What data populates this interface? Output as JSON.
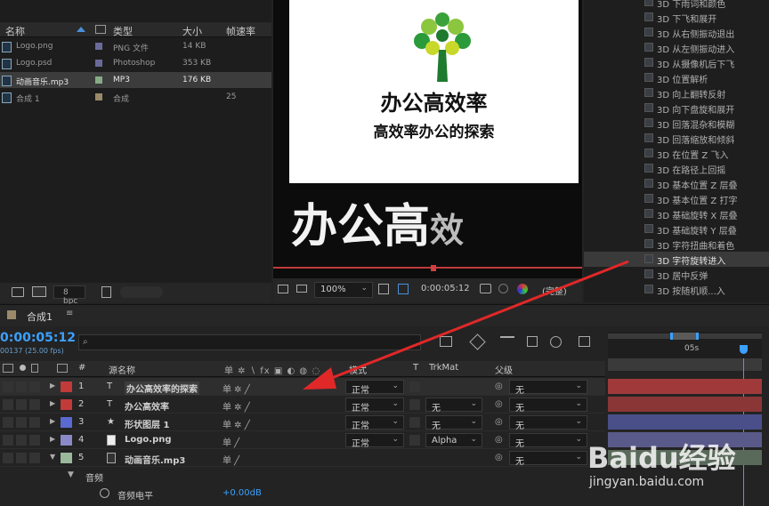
{
  "project": {
    "columns": {
      "name": "名称",
      "type": "类型",
      "size": "大小",
      "fps": "帧速率"
    },
    "items": [
      {
        "name": "Logo.png",
        "color": "#6a6a9a",
        "type": "PNG 文件",
        "size": "14 KB",
        "fps": ""
      },
      {
        "name": "Logo.psd",
        "color": "#6a6a9a",
        "type": "Photoshop",
        "size": "353 KB",
        "fps": ""
      },
      {
        "name": "动画音乐.mp3",
        "color": "#88aa88",
        "type": "MP3",
        "size": "176 KB",
        "fps": ""
      },
      {
        "name": "合成 1",
        "color": "#9a8a6a",
        "type": "合成",
        "size": "",
        "fps": "25"
      }
    ],
    "bpc": "8 bpc"
  },
  "viewer": {
    "logo_line1": "办公高效率",
    "logo_line2": "高效率办公的探索",
    "animated_text": "办公高",
    "animated_text_faded": "效",
    "zoom": "100%",
    "timecode": "0:00:05:12",
    "quality": "(完整)"
  },
  "effects": {
    "items": [
      "3D 下雨词和颜色",
      "3D 下飞和展开",
      "3D 从右侧振动退出",
      "3D 从左侧振动进入",
      "3D 从摄像机后下飞",
      "3D 位置解析",
      "3D 向上翻转反射",
      "3D 向下盘旋和展开",
      "3D 回落混杂和模糊",
      "3D 回落缩放和倾斜",
      "3D 在位置 Z 飞入",
      "3D 在路径上回摇",
      "3D 基本位置 Z 层叠",
      "3D 基本位置 Z 打字",
      "3D 基础旋转 X 层叠",
      "3D 基础旋转 Y 层叠",
      "3D 字符扭曲和着色",
      "3D 字符旋转进入",
      "3D 居中反弹",
      "3D 按随机顺...入"
    ],
    "selected_index": 17
  },
  "timeline": {
    "tab": "合成1",
    "timecode": "0:00:05:12",
    "frame_info": "00137 (25.00 fps)",
    "search_placeholder": "ρ.",
    "ruler_label": "05s",
    "headers": {
      "num": "#",
      "source": "源名称",
      "mode": "模式",
      "t": "T",
      "trkmat": "TrkMat",
      "parent": "父级"
    },
    "layers": [
      {
        "num": "1",
        "kind": "T",
        "name": "办公高效率的探索",
        "color": "#c23a3a",
        "mode": "正常",
        "trkmat": "",
        "parent": "无",
        "bar": "#a03a3a"
      },
      {
        "num": "2",
        "kind": "T",
        "name": "办公高效率",
        "color": "#c23a3a",
        "mode": "正常",
        "trkmat": "无",
        "parent": "无",
        "bar": "#8a3636"
      },
      {
        "num": "3",
        "kind": "★",
        "name": "形状图层 1",
        "color": "#5a6ad0",
        "mode": "正常",
        "trkmat": "无",
        "parent": "无",
        "bar": "#4a4f8a"
      },
      {
        "num": "4",
        "kind": "",
        "name": "Logo.png",
        "color": "#8a8ac8",
        "mode": "正常",
        "trkmat": "Alpha",
        "parent": "无",
        "bar": "#5a5a8a"
      },
      {
        "num": "5",
        "kind": "",
        "name": "动画音乐.mp3",
        "color": "#9ab89a",
        "mode": "",
        "trkmat": "",
        "parent": "无",
        "bar": "#5a6a5a"
      }
    ],
    "audio_group": "音频",
    "audio_level_label": "音频电平",
    "audio_level_value": "+0.00dB"
  },
  "watermark": {
    "brand": "Baidu经验",
    "url": "jingyan.baidu.com"
  }
}
